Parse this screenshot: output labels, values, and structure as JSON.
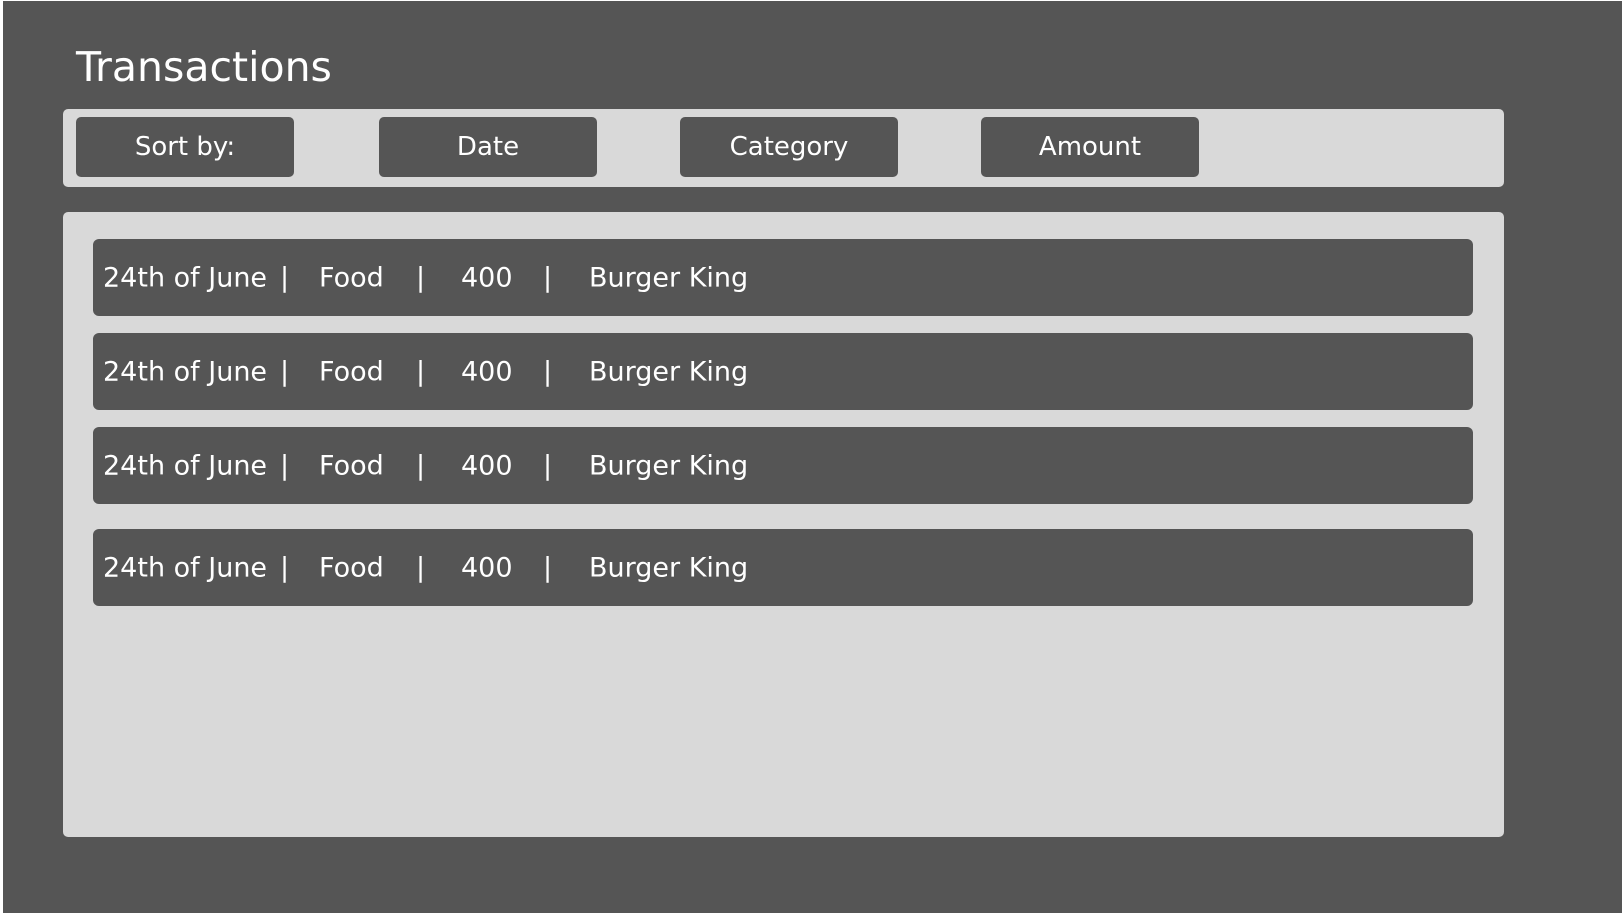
{
  "page": {
    "title": "Transactions"
  },
  "sort_bar": {
    "label": "Sort by:",
    "options": [
      "Date",
      "Category",
      "Amount"
    ]
  },
  "separator": "|",
  "transactions": [
    {
      "date": "24th of June",
      "category": "Food",
      "amount": "400",
      "merchant": "Burger King"
    },
    {
      "date": "24th of June",
      "category": "Food",
      "amount": "400",
      "merchant": "Burger King"
    },
    {
      "date": "24th of June",
      "category": "Food",
      "amount": "400",
      "merchant": "Burger King"
    },
    {
      "date": "24th of June",
      "category": "Food",
      "amount": "400",
      "merchant": "Burger King"
    }
  ],
  "colors": {
    "background": "#555555",
    "panel": "#d9d9d9",
    "text": "#ffffff"
  }
}
